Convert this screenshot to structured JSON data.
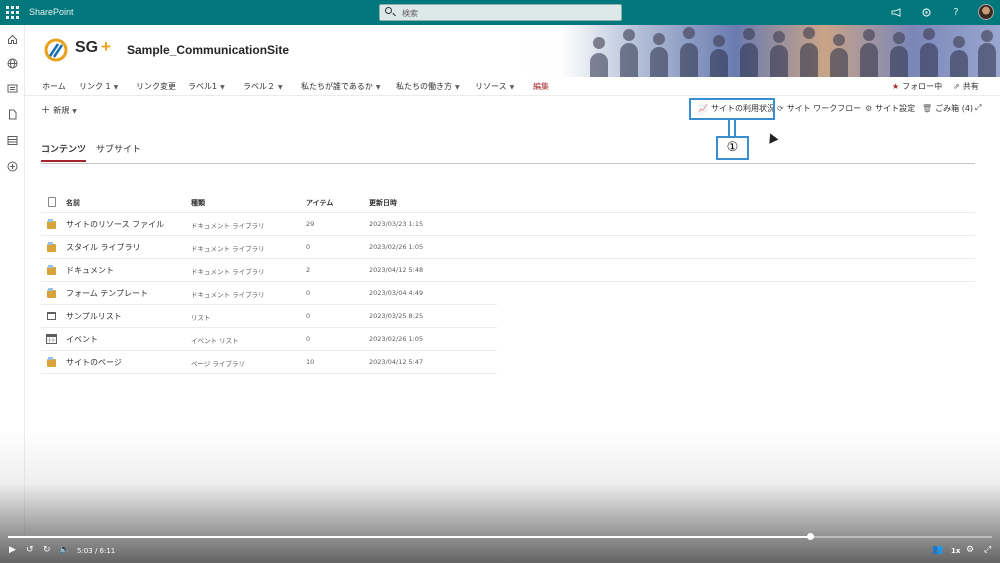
{
  "suitebar": {
    "app_name": "SharePoint",
    "search_placeholder": "検索",
    "icons": [
      "waffle-icon",
      "megaphone-icon",
      "settings-icon",
      "help-icon",
      "avatar"
    ]
  },
  "site": {
    "logo_text": "SG",
    "logo_plus": "+",
    "title": "Sample_CommunicationSite"
  },
  "topnav": {
    "items": [
      {
        "label": "ホーム",
        "has_chevron": false
      },
      {
        "label": "リンク 1",
        "has_chevron": true
      },
      {
        "label": "リンク変更",
        "has_chevron": false
      },
      {
        "label": "ラベル1",
        "has_chevron": true
      },
      {
        "label": "ラベル２",
        "has_chevron": true
      },
      {
        "label": "私たちが誰であるか",
        "has_chevron": true
      },
      {
        "label": "私たちの働き方",
        "has_chevron": true
      },
      {
        "label": "リソース",
        "has_chevron": true
      }
    ],
    "edit_label": "編集",
    "follow_label": "フォロー中",
    "share_label": "共有"
  },
  "commandbar": {
    "new_label": "新規",
    "site_usage_label": "サイトの利用状況",
    "workflow_label": "サイト ワークフロー",
    "settings_label": "サイト設定",
    "recycle_label": "ごみ箱 (4)"
  },
  "annotation": {
    "callout_label": "①",
    "accent_color": "#3a8fd1"
  },
  "tabs": {
    "contents": "コンテンツ",
    "subsites": "サブサイト"
  },
  "table": {
    "headers": {
      "name": "名前",
      "type": "種類",
      "items": "アイテム",
      "modified": "更新日時"
    },
    "rows": [
      {
        "icon": "library-icon",
        "name": "サイトのリソース ファイル",
        "type": "ドキュメント ライブラリ",
        "items": "29",
        "modified": "2023/03/23 1:15"
      },
      {
        "icon": "library-icon",
        "name": "スタイル ライブラリ",
        "type": "ドキュメント ライブラリ",
        "items": "0",
        "modified": "2023/02/26 1:05"
      },
      {
        "icon": "library-icon",
        "name": "ドキュメント",
        "type": "ドキュメント ライブラリ",
        "items": "2",
        "modified": "2023/04/12 5:48"
      },
      {
        "icon": "library-icon",
        "name": "フォーム テンプレート",
        "type": "ドキュメント ライブラリ",
        "items": "0",
        "modified": "2023/03/04 4:49"
      },
      {
        "icon": "list-icon",
        "name": "サンプルリスト",
        "type": "リスト",
        "items": "0",
        "modified": "2023/03/25 8:25"
      },
      {
        "icon": "calendar-icon",
        "name": "イベント",
        "type": "イベント リスト",
        "items": "0",
        "modified": "2023/02/26 1:05"
      },
      {
        "icon": "library-icon",
        "name": "サイトのページ",
        "type": "ページ ライブラリ",
        "items": "10",
        "modified": "2023/04/12 5:47"
      }
    ]
  },
  "video": {
    "time": "5:03 / 6:11",
    "progress": 0.815,
    "speed": "1x"
  },
  "colors": {
    "suitebar": "#03787c",
    "accent_red": "#a4262c"
  }
}
